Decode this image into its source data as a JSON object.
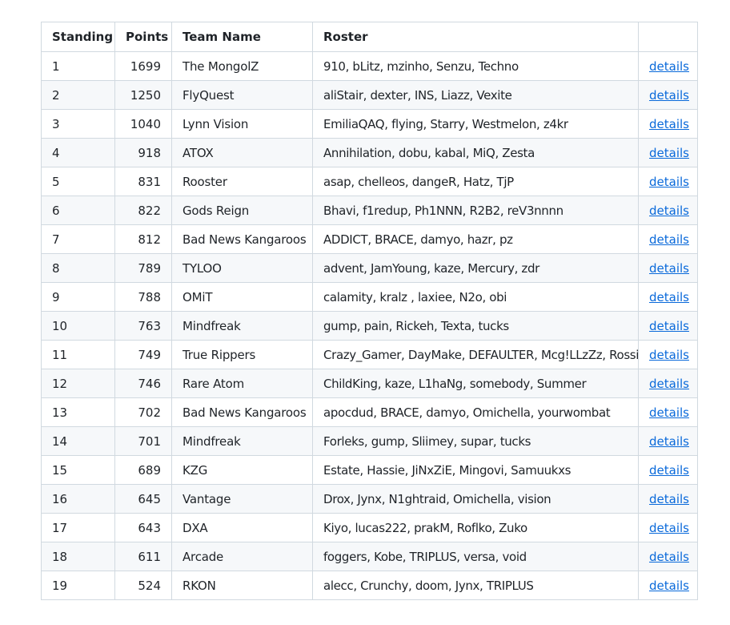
{
  "table": {
    "headers": {
      "standing": "Standing",
      "points": "Points",
      "team": "Team Name",
      "roster": "Roster",
      "details": ""
    },
    "rows": [
      {
        "standing": "1",
        "points": "1699",
        "team": "The MongolZ",
        "roster": "910, bLitz, mzinho, Senzu, Techno",
        "details": "details"
      },
      {
        "standing": "2",
        "points": "1250",
        "team": "FlyQuest",
        "roster": "aliStair, dexter, INS, Liazz, Vexite",
        "details": "details"
      },
      {
        "standing": "3",
        "points": "1040",
        "team": "Lynn Vision",
        "roster": "EmiliaQAQ, flying, Starry, Westmelon, z4kr",
        "details": "details"
      },
      {
        "standing": "4",
        "points": "918",
        "team": "ATOX",
        "roster": "Annihilation, dobu, kabal, MiQ, Zesta",
        "details": "details"
      },
      {
        "standing": "5",
        "points": "831",
        "team": "Rooster",
        "roster": "asap, chelleos, dangeR, Hatz, TjP",
        "details": "details"
      },
      {
        "standing": "6",
        "points": "822",
        "team": "Gods Reign",
        "roster": "Bhavi, f1redup, Ph1NNN, R2B2, reV3nnnn",
        "details": "details"
      },
      {
        "standing": "7",
        "points": "812",
        "team": "Bad News Kangaroos",
        "roster": "ADDICT, BRACE, damyo, hazr, pz",
        "details": "details"
      },
      {
        "standing": "8",
        "points": "789",
        "team": "TYLOO",
        "roster": "advent, JamYoung, kaze, Mercury, zdr",
        "details": "details"
      },
      {
        "standing": "9",
        "points": "788",
        "team": "OMiT",
        "roster": "calamity, kralz , laxiee, N2o, obi",
        "details": "details"
      },
      {
        "standing": "10",
        "points": "763",
        "team": "Mindfreak",
        "roster": "gump, pain, Rickeh, Texta, tucks",
        "details": "details"
      },
      {
        "standing": "11",
        "points": "749",
        "team": "True Rippers",
        "roster": "Crazy_Gamer, DayMake, DEFAULTER, Mcg!LLzZz, Rossi",
        "details": "details"
      },
      {
        "standing": "12",
        "points": "746",
        "team": "Rare Atom",
        "roster": "ChildKing, kaze, L1haNg, somebody, Summer",
        "details": "details"
      },
      {
        "standing": "13",
        "points": "702",
        "team": "Bad News Kangaroos",
        "roster": "apocdud, BRACE, damyo, Omichella, yourwombat",
        "details": "details"
      },
      {
        "standing": "14",
        "points": "701",
        "team": "Mindfreak",
        "roster": "Forleks, gump, Sliimey, supar, tucks",
        "details": "details"
      },
      {
        "standing": "15",
        "points": "689",
        "team": "KZG",
        "roster": "Estate, Hassie, JiNxZiE, Mingovi, Samuukxs",
        "details": "details"
      },
      {
        "standing": "16",
        "points": "645",
        "team": "Vantage",
        "roster": "Drox, Jynx, N1ghtraid, Omichella, vision",
        "details": "details"
      },
      {
        "standing": "17",
        "points": "643",
        "team": "DXA",
        "roster": "Kiyo, lucas222, prakM, Roflko, Zuko",
        "details": "details"
      },
      {
        "standing": "18",
        "points": "611",
        "team": "Arcade",
        "roster": "foggers, Kobe, TRIPLUS, versa, void",
        "details": "details"
      },
      {
        "standing": "19",
        "points": "524",
        "team": "RKON",
        "roster": "alecc, Crunchy, doom, Jynx, TRIPLUS",
        "details": "details"
      }
    ]
  },
  "colors": {
    "link": "#0969da",
    "border": "#d1d9e0",
    "stripe": "#f6f8fa"
  }
}
